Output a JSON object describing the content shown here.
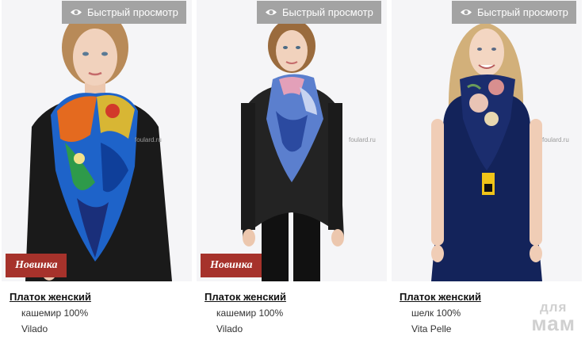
{
  "quick_view_label": "Быстрый просмотр",
  "products": [
    {
      "badge": "Новинка",
      "title": "Платок женский",
      "material": "кашемир 100%",
      "brand": "Vilado",
      "photo_tag": "foulard.ru"
    },
    {
      "badge": "Новинка",
      "title": "Платок женский",
      "material": "кашемир 100%",
      "brand": "Vilado",
      "photo_tag": "foulard.ru"
    },
    {
      "badge": "",
      "title": "Платок женский",
      "material": "шелк 100%",
      "brand": "Vita Pelle",
      "photo_tag": "foulard.ru"
    }
  ],
  "watermark": {
    "line1": "для",
    "line2": "мам"
  },
  "colors": {
    "badge": "#a6322b",
    "quick_view_bg": "#a3a3a3"
  }
}
